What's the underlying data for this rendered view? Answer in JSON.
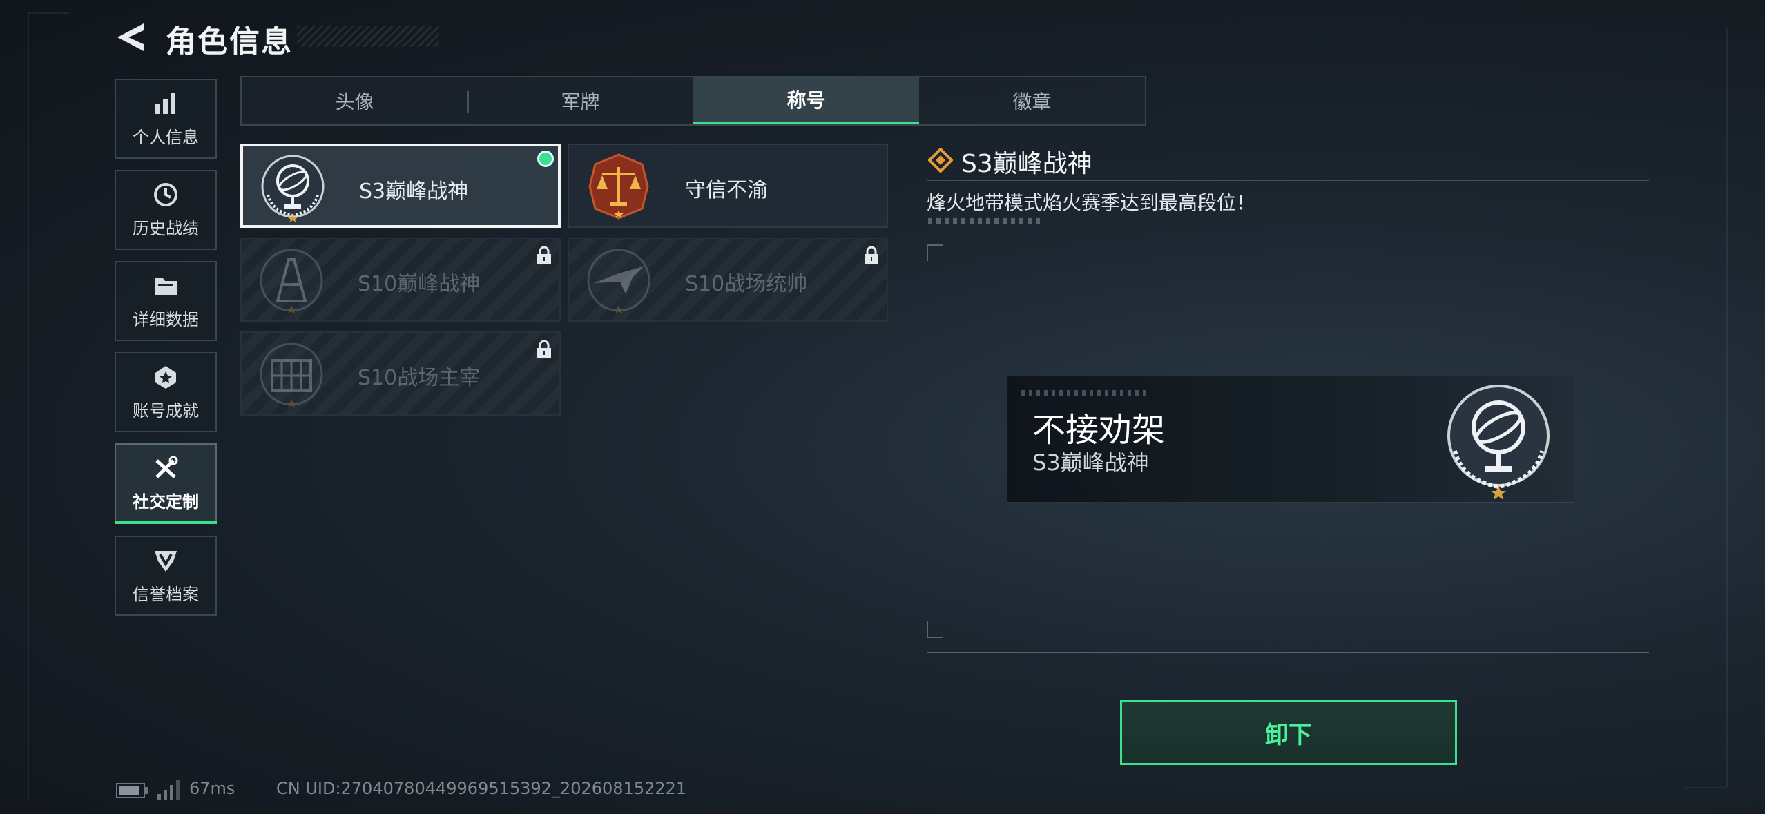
{
  "header": {
    "title": "角色信息"
  },
  "sidebar": {
    "items": [
      {
        "label": "个人信息",
        "icon": "bar-chart-icon"
      },
      {
        "label": "历史战绩",
        "icon": "history-clock-icon"
      },
      {
        "label": "详细数据",
        "icon": "folder-icon"
      },
      {
        "label": "账号成就",
        "icon": "achievement-badge-icon"
      },
      {
        "label": "社交定制",
        "icon": "tools-icon",
        "active": true
      },
      {
        "label": "信誉档案",
        "icon": "shield-v-icon"
      }
    ]
  },
  "tabs": [
    {
      "label": "头像"
    },
    {
      "label": "军牌"
    },
    {
      "label": "称号",
      "active": true
    },
    {
      "label": "徽章"
    }
  ],
  "titles": [
    {
      "name": "S3巅峰战神",
      "state": "selected-equipped",
      "icon": "armillary-sphere-icon"
    },
    {
      "name": "守信不渝",
      "state": "unlocked",
      "icon": "scales-of-justice-icon"
    },
    {
      "name": "S10巅峰战神",
      "state": "locked",
      "icon": "tower-icon"
    },
    {
      "name": "S10战场统帅",
      "state": "locked",
      "icon": "fighter-jet-icon"
    },
    {
      "name": "S10战场主宰",
      "state": "locked",
      "icon": "colosseum-icon"
    }
  ],
  "detail": {
    "title": "S3巅峰战神",
    "description": "烽火地带模式焰火赛季达到最高段位！",
    "preview": {
      "player_name": "不接劝架",
      "title": "S3巅峰战神"
    },
    "action_label": "卸下"
  },
  "footer": {
    "ping": "67ms",
    "uid": "CN UID:27040780449969515392_202608152221"
  },
  "colors": {
    "accent": "#3ee08f",
    "gold": "#d9a23a",
    "bronze": "#b5542a"
  }
}
